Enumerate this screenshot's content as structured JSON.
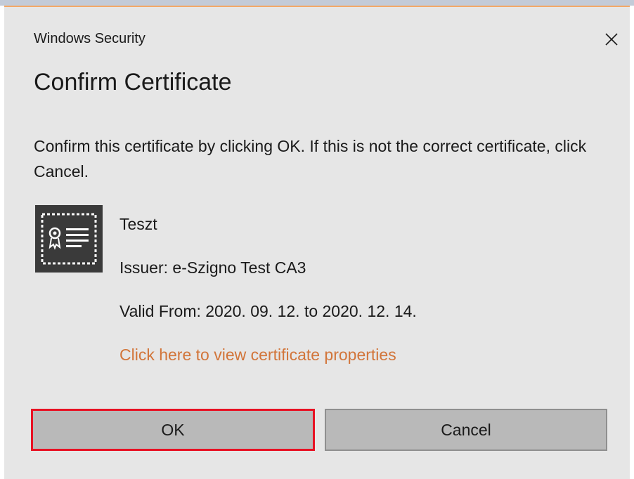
{
  "window": {
    "title": "Windows Security",
    "close_icon": "close-icon"
  },
  "dialog": {
    "heading": "Confirm Certificate",
    "message": "Confirm this certificate by clicking OK. If this is not the correct certificate, click Cancel."
  },
  "certificate": {
    "icon": "certificate-icon",
    "name": "Teszt",
    "issuer": "Issuer: e-Szigno Test CA3",
    "valid": "Valid From: 2020. 09. 12. to 2020. 12. 14.",
    "link": "Click here to view certificate properties"
  },
  "buttons": {
    "ok_label": "OK",
    "cancel_label": "Cancel"
  },
  "colors": {
    "link": "#d2753a",
    "focus_border": "#e81123",
    "dialog_bg": "#e6e6e6",
    "button_bg": "#b9b9b9"
  }
}
